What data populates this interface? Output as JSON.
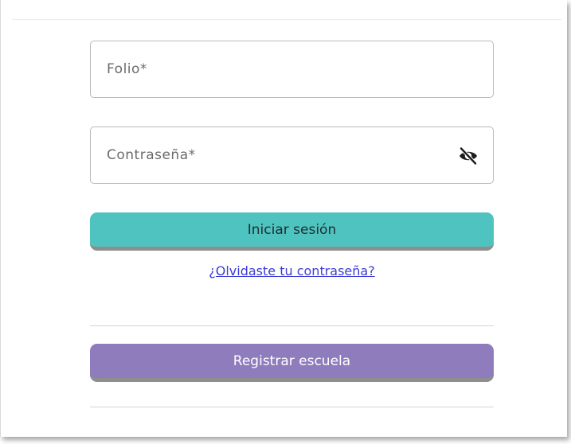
{
  "form": {
    "folio": {
      "placeholder": "Folio*",
      "value": ""
    },
    "password": {
      "placeholder": "Contraseña*",
      "value": "",
      "toggle_icon": "eye-slash-icon"
    },
    "login_button": {
      "label": "Iniciar sesión",
      "color": "#4ec3c0"
    },
    "forgot_password_link": "¿Olvidaste tu contraseña?",
    "register_button": {
      "label": "Registrar escuela",
      "color": "#8f7cbd"
    }
  }
}
